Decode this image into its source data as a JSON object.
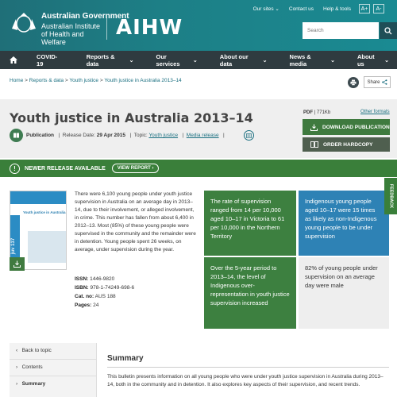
{
  "header": {
    "gov_line1": "Australian Government",
    "gov_line2": "Australian Institute of Health and Welfare",
    "logo_text": "AIHW",
    "top_links": [
      "Our sites",
      "Contact us",
      "Help & tools"
    ],
    "font_up": "A+",
    "font_down": "A-",
    "search_placeholder": "Search"
  },
  "nav": {
    "items": [
      "COVID-19",
      "Reports & data",
      "Our services",
      "About our data",
      "News & media",
      "About us"
    ]
  },
  "breadcrumb": [
    "Home",
    "Reports & data",
    "Youth justice",
    "Youth justice in Australia 2013–14"
  ],
  "share_label": "Share",
  "page": {
    "title": "Youth justice in Australia 2013–14",
    "type": "Publication",
    "release_label": "Release Date:",
    "release_date": "29 Apr 2015",
    "topic_label": "Topic:",
    "topic": "Youth justice",
    "media_release": "Media release",
    "pdf_label": "PDF",
    "pdf_size": "771Kb",
    "other_formats": "Other formats",
    "download_label": "DOWNLOAD PUBLICATION",
    "order_label": "ORDER HARDCOPY"
  },
  "newer": {
    "text": "NEWER RELEASE AVAILABLE",
    "button": "VIEW REPORT"
  },
  "cover": {
    "title": "Youth justice in Australia",
    "side_text": "juv 137"
  },
  "summary_text": "There were 6,100 young people under youth justice supervision in Australia on an average day in 2013–14, due to their involvement, or alleged involvement, in crime. This number has fallen from about 6,400 in 2012–13. Most (85%) of these young people were supervised in the community and the remainder were in detention. Young people spent 26 weeks, on average, under supervision during the year.",
  "details": {
    "issn_label": "ISSN:",
    "issn": "1446-9820",
    "isbn_label": "ISBN:",
    "isbn": "978-1-74249-698-6",
    "cat_label": "Cat. no:",
    "cat": "AUS 188",
    "pages_label": "Pages:",
    "pages": "24"
  },
  "tiles": [
    "The rate of supervision ranged from 14 per 10,000 aged 10–17 in Victoria to 61 per 10,000 in the Northern Territory",
    "Indigenous young people aged 10–17 were 15 times as likely as non-Indigenous young people to be under supervision",
    "Over the 5-year period to 2013–14, the level of Indigenous over-representation in youth justice supervision increased",
    "82% of young people under supervision on an average day were male"
  ],
  "feedback": "FEEDBACK",
  "sidenav": {
    "back": "Back to topic",
    "contents": "Contents",
    "summary": "Summary"
  },
  "section": {
    "heading": "Summary",
    "text": "This bulletin presents information on all young people who were under youth justice supervision in Australia during 2013–14, both in the community and in detention. It also explores key aspects of their supervision, and recent trends."
  },
  "colors": {
    "header_teal": "#1d7f86",
    "nav_dark": "#2f3b40",
    "green": "#3d8040",
    "blue": "#2e82b5"
  }
}
